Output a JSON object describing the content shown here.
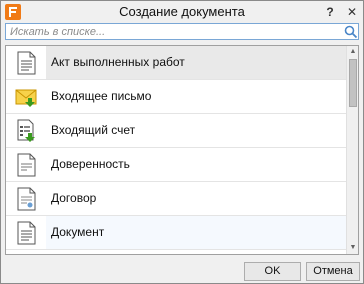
{
  "window": {
    "title": "Создание документа",
    "help_label": "?",
    "close_label": "✕"
  },
  "search": {
    "placeholder": "Искать в списке..."
  },
  "items": [
    {
      "label": "Акт выполненных работ",
      "icon": "document-lines-icon",
      "state": "selected"
    },
    {
      "label": "Входящее письмо",
      "icon": "incoming-envelope-icon",
      "state": "normal"
    },
    {
      "label": "Входящий счет",
      "icon": "incoming-invoice-icon",
      "state": "normal"
    },
    {
      "label": "Доверенность",
      "icon": "document-power-of-attorney-icon",
      "state": "normal"
    },
    {
      "label": "Договор",
      "icon": "document-contract-icon",
      "state": "normal"
    },
    {
      "label": "Документ",
      "icon": "document-generic-icon",
      "state": "hover"
    }
  ],
  "footer": {
    "ok_label": "OK",
    "cancel_label": "Отмена"
  },
  "colors": {
    "accent": "#f07a16",
    "arrow_green": "#3a9a1f",
    "envelope_yellow": "#f2b705"
  }
}
